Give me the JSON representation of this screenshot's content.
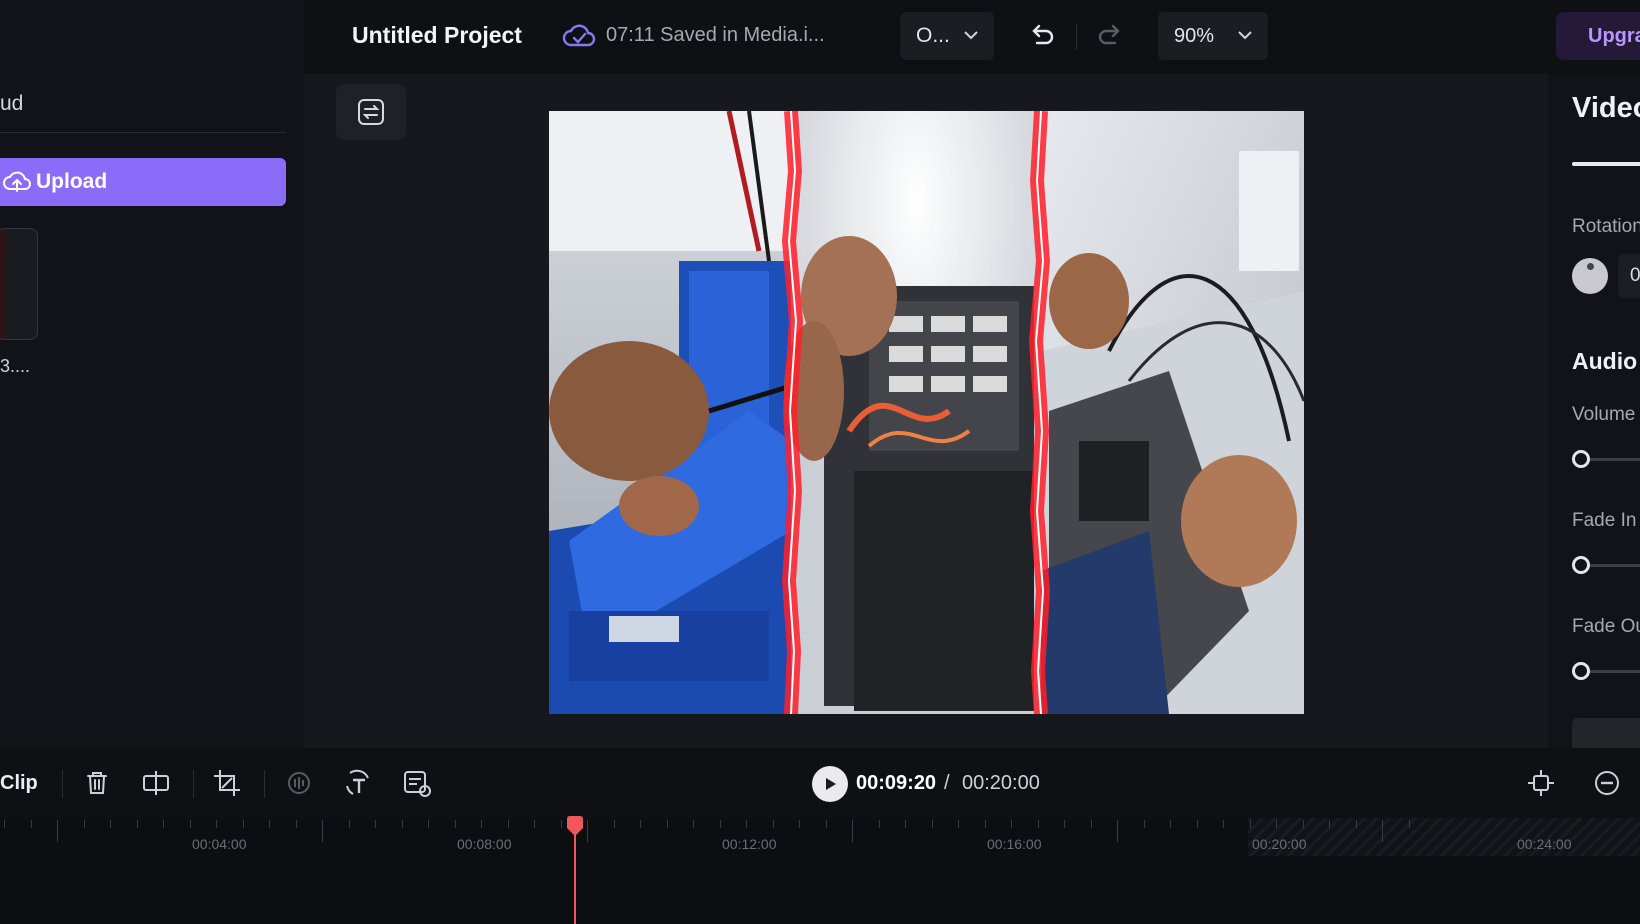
{
  "left_panel": {
    "title": "ud",
    "upload_label": "Upload",
    "media_name": "3...."
  },
  "header": {
    "project_title": "Untitled Project",
    "save_status": "07:11 Saved in Media.i...",
    "ratio_value": "O...",
    "zoom_value": "90%",
    "upgrade_label": "Upgra"
  },
  "right_panel": {
    "heading": "Video",
    "rotation_label": "Rotation",
    "rotation_value": "0",
    "audio_heading": "Audio",
    "volume_label": "Volume",
    "fade_in_label": "Fade In",
    "fade_out_label": "Fade Out"
  },
  "timeline": {
    "clip_label": "Clip",
    "current_time": "00:09:20",
    "separator": "/",
    "total_time": "00:20:00",
    "ticks": [
      "00:04:00",
      "00:08:00",
      "00:12:00",
      "00:16:00",
      "00:20:00",
      "00:24:00"
    ]
  },
  "icons": {
    "upload": "cloud-upload-icon",
    "save": "cloud-check-icon",
    "undo": "undo-icon",
    "redo": "redo-icon",
    "chevron": "chevron-down-icon",
    "toggle": "swap-icon",
    "delete": "trash-icon",
    "split": "split-icon",
    "crop": "crop-icon",
    "play": "play-icon",
    "fit": "fit-timeline-icon",
    "zoom_out": "zoom-out-icon"
  },
  "colors": {
    "accent": "#8a6cf9",
    "playhead": "#f0565a",
    "upgrade_text": "#b896ff",
    "background": "#0e0f13"
  }
}
